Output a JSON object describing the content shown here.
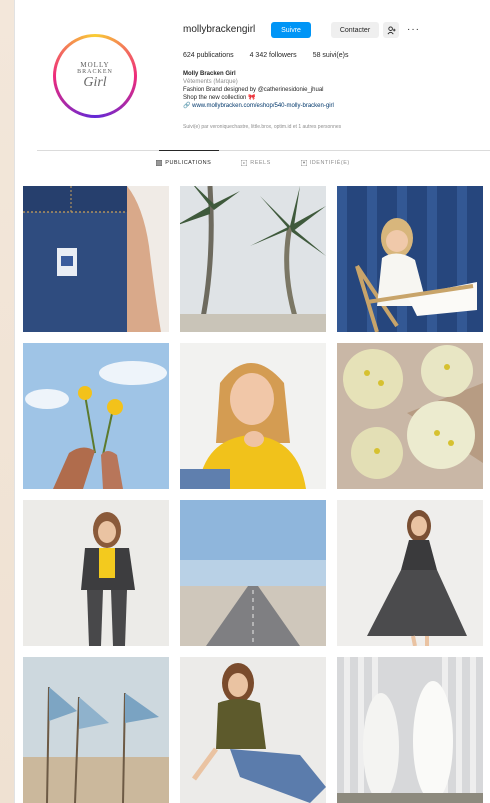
{
  "profile": {
    "username": "mollybrackengirl",
    "follow_label": "Suivre",
    "contact_label": "Contacter",
    "add_label": "+",
    "more_label": "···",
    "stats": {
      "publications": "624 publications",
      "followers": "4 342 followers",
      "following": "58 suivi(e)s"
    },
    "bio": {
      "name": "Molly Bracken Girl",
      "category": "Vêtements (Marque)",
      "line1": "Fashion Brand designed by @catherinesidonie_jhual",
      "line2": "Shop the new collection 🎀",
      "link": "www.mollybracken.com/eshop/540-molly-bracken-girl"
    },
    "followed_by": "Suivi(e) par veroniquechastre, little.brox, optim.id et 1 autres personnes",
    "avatar": {
      "line1": "MOLLY",
      "line2": "BRACKEN",
      "line3": "Girl"
    }
  },
  "tabs": [
    {
      "label": "PUBLICATIONS",
      "icon": "grid-icon",
      "active": true
    },
    {
      "label": "REELS",
      "icon": "reels-icon",
      "active": false
    },
    {
      "label": "IDENTIFIÉ(E)",
      "icon": "tag-icon",
      "active": false
    }
  ],
  "grid_posts": [
    "denim-pocket-label",
    "palm-trees",
    "girl-deck-chair",
    "hand-yellow-flowers",
    "smiling-girl-yellow-top",
    "daisy-bouquets",
    "girl-floral-suit",
    "desert-road",
    "girl-floral-dress",
    "beach-flags",
    "girl-khaki-top-jeans",
    "white-surfboards"
  ],
  "colors": {
    "accent": "#0095f6",
    "text": "#262626",
    "muted": "#8e8e8e"
  }
}
